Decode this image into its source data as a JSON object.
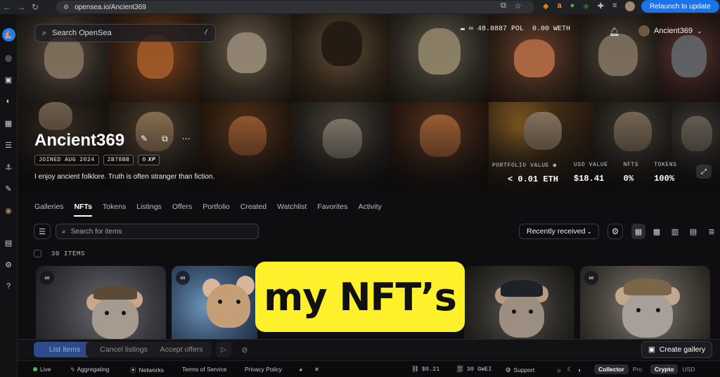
{
  "browser": {
    "url": "opensea.io/Ancient369",
    "relaunch_label": "Relaunch to update"
  },
  "header": {
    "search_placeholder": "Search OpenSea",
    "search_shortcut": "/",
    "balance_pol": "48.8887 POL",
    "balance_weth": "0.00 WETH",
    "account_name": "Ancient369"
  },
  "profile": {
    "name": "Ancient369",
    "joined": "JOINED AUG 2024",
    "address": "2B78BB",
    "xp": "0",
    "xp_label": "XP",
    "bio": "I enjoy ancient folklore. Truth is often stranger than fiction.",
    "stats": [
      {
        "label": "PORTFOLIO VALUE",
        "value": "< 0.01 ETH"
      },
      {
        "label": "USD VALUE",
        "value": "$18.41"
      },
      {
        "label": "NFTS",
        "value": "0%"
      },
      {
        "label": "TOKENS",
        "value": "100%"
      }
    ]
  },
  "tabs": [
    "Galleries",
    "NFTs",
    "Tokens",
    "Listings",
    "Offers",
    "Portfolio",
    "Created",
    "Watchlist",
    "Favorites",
    "Activity"
  ],
  "active_tab": "NFTs",
  "toolbar": {
    "items_search_placeholder": "Search for items",
    "sort_label": "Recently received",
    "item_count": "30 ITEMS"
  },
  "overlay_text": "my NFT’s",
  "action_bar": {
    "list_items": "List items",
    "cancel_listings": "Cancel listings",
    "accept_offers": "Accept offers",
    "create_gallery": "Create gallery"
  },
  "status_bar": {
    "live": "Live",
    "aggregating": "Aggregating",
    "networks": "Networks",
    "terms": "Terms of Service",
    "privacy": "Privacy Policy",
    "eth_price": "$0.21",
    "gas": "30 GWEI",
    "support": "Support",
    "mode_collector": "Collector",
    "mode_pro": "Pro",
    "currency_crypto": "Crypto",
    "currency_usd": "USD"
  },
  "colors": {
    "accent_blue": "#2081e2",
    "relaunch_blue": "#1a73e8",
    "overlay_yellow": "#fef02a",
    "live_green": "#34c759"
  }
}
